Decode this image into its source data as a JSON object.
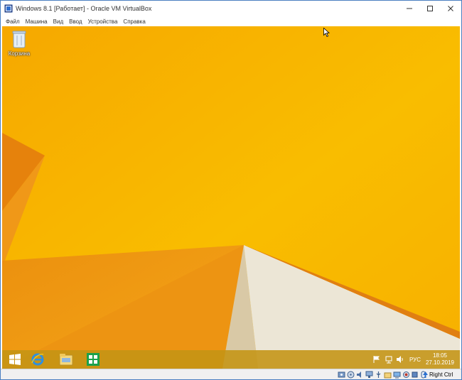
{
  "window": {
    "title": "Windows 8.1 [Работает] - Oracle VM VirtualBox",
    "minimize_icon": "minimize-icon",
    "maximize_icon": "maximize-icon",
    "close_icon": "close-icon"
  },
  "menubar": {
    "items": [
      {
        "label": "Файл"
      },
      {
        "label": "Машина"
      },
      {
        "label": "Вид"
      },
      {
        "label": "Ввод"
      },
      {
        "label": "Устройства"
      },
      {
        "label": "Справка"
      }
    ]
  },
  "desktop": {
    "recycle_bin_label": "Корзина",
    "wallpaper_colors": {
      "primary": "#f8b700",
      "shade": "#e98a0a",
      "light": "#ece6d6"
    }
  },
  "taskbar": {
    "apps": [
      "windows-start-icon",
      "internet-explorer-icon",
      "file-explorer-icon",
      "store-icon"
    ],
    "language": "РУС",
    "time": "18:05",
    "date": "27.10.2019"
  },
  "statusbar": {
    "host_key": "Right Ctrl",
    "icons": [
      "hard-disk-icon",
      "optical-drive-icon",
      "audio-icon",
      "network-icon",
      "usb-icon",
      "shared-folder-icon",
      "display-icon",
      "recording-icon",
      "cpu-icon",
      "mouse-integration-icon",
      "keyboard-icon"
    ]
  }
}
